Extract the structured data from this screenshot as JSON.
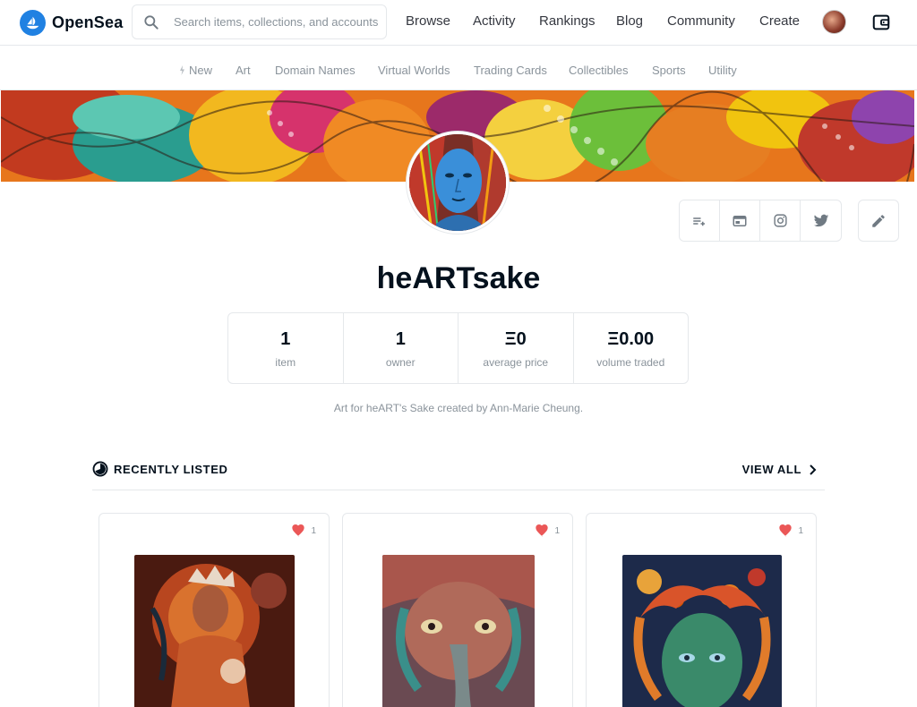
{
  "header": {
    "logo_text": "OpenSea",
    "search_placeholder": "Search items, collections, and accounts",
    "nav": [
      "Browse",
      "Activity",
      "Rankings",
      "Blog",
      "Community",
      "Create"
    ]
  },
  "categories": [
    "New",
    "Art",
    "Domain Names",
    "Virtual Worlds",
    "Trading Cards",
    "Collectibles",
    "Sports",
    "Utility"
  ],
  "profile": {
    "name": "heARTsake",
    "description": "Art for heART's Sake created by Ann-Marie Cheung."
  },
  "stats": [
    {
      "value": "1",
      "label": "item"
    },
    {
      "value": "1",
      "label": "owner"
    },
    {
      "value": "Ξ0",
      "label": "average price"
    },
    {
      "value": "Ξ0.00",
      "label": "volume traded"
    }
  ],
  "section": {
    "title": "RECENTLY LISTED",
    "view_all": "VIEW ALL"
  },
  "cards": [
    {
      "likes": "1"
    },
    {
      "likes": "1"
    },
    {
      "likes": "1"
    }
  ],
  "colors": {
    "brand": "#2081e2",
    "heart": "#eb5757",
    "muted_text": "#8a939b",
    "border": "#e5e8eb"
  },
  "icons": [
    "search-icon",
    "wallet-icon",
    "sparkle-icon",
    "playlist-icon",
    "website-icon",
    "instagram-icon",
    "twitter-icon",
    "pencil-icon",
    "recent-icon",
    "chevron-right-icon",
    "heart-icon"
  ]
}
